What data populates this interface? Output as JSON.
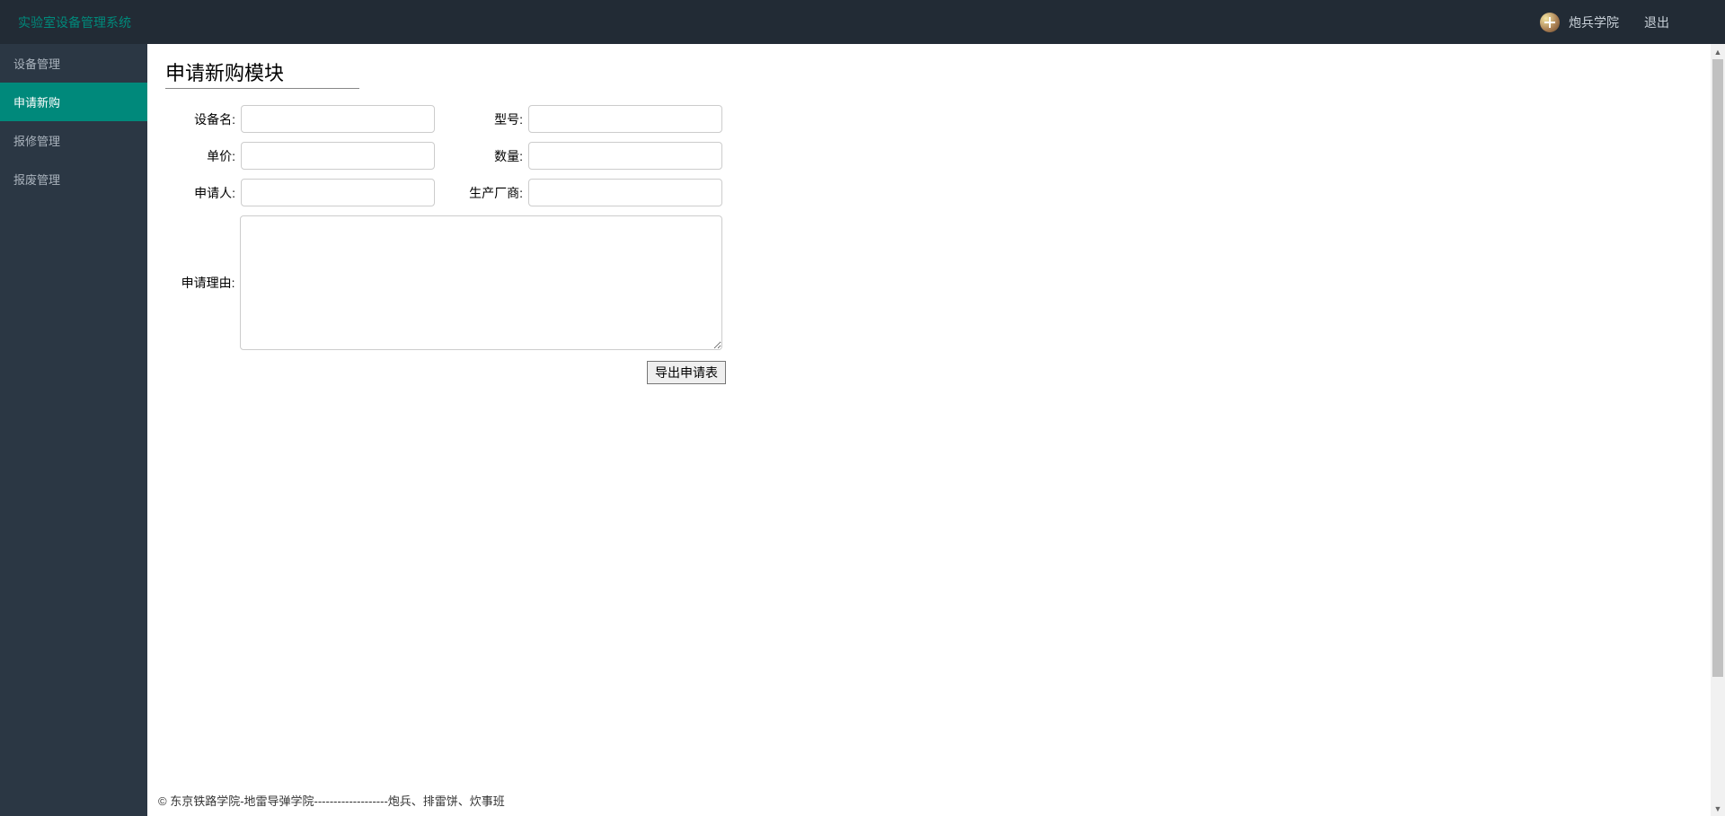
{
  "header": {
    "brand": "实验室设备管理系统",
    "username": "炮兵学院",
    "logout_label": "退出"
  },
  "sidebar": {
    "items": [
      {
        "label": "设备管理",
        "active": false
      },
      {
        "label": "申请新购",
        "active": true
      },
      {
        "label": "报修管理",
        "active": false
      },
      {
        "label": "报废管理",
        "active": false
      }
    ]
  },
  "page": {
    "title": "申请新购模块"
  },
  "form": {
    "equipment_name_label": "设备名:",
    "equipment_name_value": "",
    "model_label": "型号:",
    "model_value": "",
    "price_label": "单价:",
    "price_value": "",
    "quantity_label": "数量:",
    "quantity_value": "",
    "applicant_label": "申请人:",
    "applicant_value": "",
    "manufacturer_label": "生产厂商:",
    "manufacturer_value": "",
    "reason_label": "申请理由:",
    "reason_value": "",
    "export_button_label": "导出申请表"
  },
  "footer": {
    "text": "© 东京铁路学院-地雷导弹学院-------------------炮兵、排雷饼、炊事班"
  }
}
